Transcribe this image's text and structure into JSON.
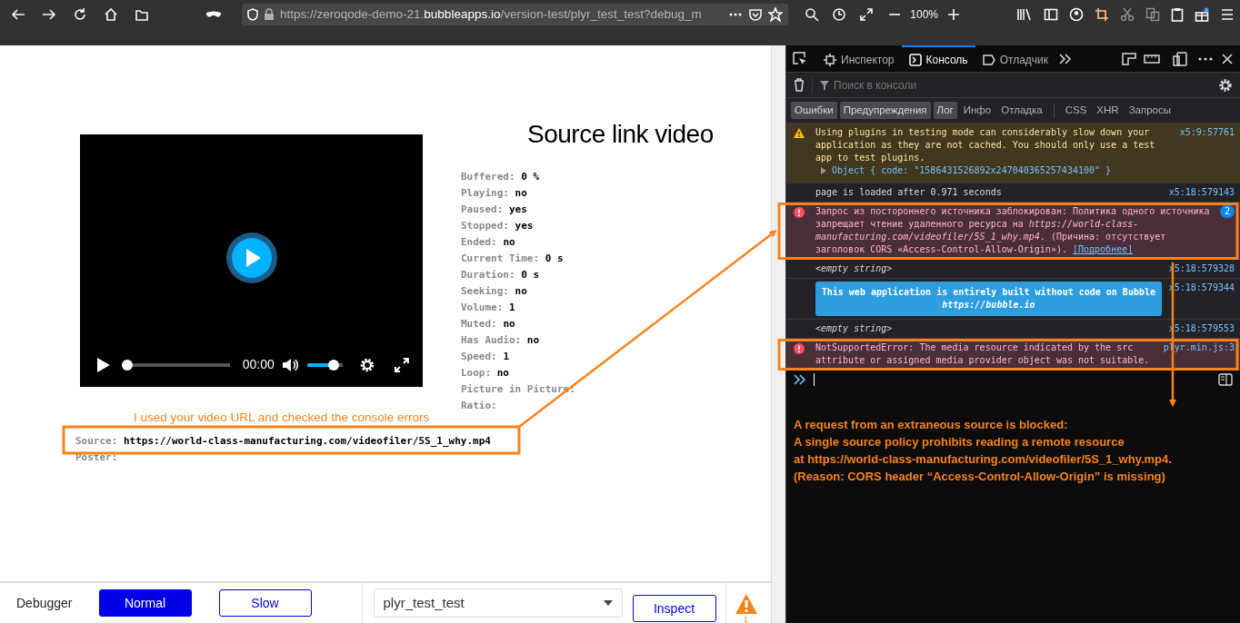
{
  "browser": {
    "url": {
      "prefix": "https://zeroqode-demo-21.",
      "domain": "bubbleapps.io",
      "path": "/version-test/plyr_test_test?debug_m"
    },
    "zoom": "100%"
  },
  "page": {
    "heading": "Source link video",
    "player": {
      "time": "00:00",
      "progress": {
        "level": 0
      },
      "volume": {
        "level": 0.85
      }
    },
    "stats": [
      {
        "label": "Buffered:",
        "value": "0 %"
      },
      {
        "label": "Playing:",
        "value": "no"
      },
      {
        "label": "Paused:",
        "value": "yes"
      },
      {
        "label": "Stopped:",
        "value": "yes"
      },
      {
        "label": "Ended:",
        "value": "no"
      },
      {
        "label": "Current Time:",
        "value": "0 s"
      },
      {
        "label": "Duration:",
        "value": "0 s"
      },
      {
        "label": "Seeking:",
        "value": "no"
      },
      {
        "label": "Volume:",
        "value": "1"
      },
      {
        "label": "Muted:",
        "value": "no"
      },
      {
        "label": "Has Audio:",
        "value": "no"
      },
      {
        "label": "Speed:",
        "value": "1"
      },
      {
        "label": "Loop:",
        "value": "no"
      },
      {
        "label": "Picture in Picture:"
      },
      {
        "label": "Ratio:"
      }
    ],
    "note": "I used your video URL and checked the console errors",
    "source": {
      "label": "Source:",
      "value": "https://world-class-manufacturing.com/videofiler/5S_1_why.mp4"
    },
    "poster": {
      "label": "Poster:"
    }
  },
  "debugger": {
    "label": "Debugger",
    "modes": [
      {
        "label": "Normal",
        "selected": true
      },
      {
        "label": "Slow",
        "selected": false
      }
    ],
    "element": "plyr_test_test",
    "inspect": "Inspect",
    "warnings": "1"
  },
  "devtools": {
    "tabs": [
      {
        "label": "Инспектор",
        "selected": false,
        "kind": "inspector"
      },
      {
        "label": "Консоль",
        "selected": true,
        "kind": "console"
      },
      {
        "label": "Отладчик",
        "selected": false,
        "kind": "debugger"
      }
    ],
    "search_placeholder": "Поиск в консоли",
    "filters": [
      {
        "label": "Ошибки",
        "selected": true
      },
      {
        "label": "Предупреждения",
        "selected": true
      },
      {
        "label": "Лог",
        "selected": true
      },
      {
        "label": "Инфо",
        "selected": false
      },
      {
        "label": "Отладка",
        "selected": false
      },
      {
        "label": "CSS",
        "selected": false
      },
      {
        "label": "XHR",
        "selected": false
      },
      {
        "label": "Запросы",
        "selected": false
      }
    ],
    "messages": [
      {
        "kind": "warning",
        "text": "Using plugins in testing mode can considerably slow down your application as they are not cached. You should only use a test app to test plugins.",
        "object": "Object { code: \"1586431526892x247040365257434100\" }",
        "location": "x5:9:57761"
      },
      {
        "kind": "log",
        "text": "page is loaded after 0.971 seconds",
        "location": "x5:18:579143"
      },
      {
        "kind": "error",
        "text": "Запрос из постороннего источника заблокирован: Политика одного источника запрещает чтение удаленного ресурса на *https://world-class-manufacturing.com/videofiler/5S_1_why.mp4*. (Причина: отсутствует заголовок CORS «Access-Control-Allow-Origin»).",
        "link": "[Подробнее]",
        "count": "2",
        "highlighted": true
      },
      {
        "kind": "empty",
        "text": "<empty string>",
        "location": "x5:18:579328"
      },
      {
        "kind": "styled",
        "text": "This web application is entirely built without code on Bubble",
        "subtext": "https://bubble.io",
        "location": "x5:18:579344"
      },
      {
        "kind": "empty",
        "text": "<empty string>",
        "location": "x5:18:579553"
      },
      {
        "kind": "error",
        "text": "NotSupportedError: The media resource indicated by the src attribute or assigned media provider object was not suitable.",
        "location": "plyr.min.js:3",
        "highlighted": true
      }
    ],
    "explanation": [
      "A request from an extraneous source is blocked:",
      "A single source policy prohibits reading a remote resource",
      "at https://world-class-manufacturing.com/videofiler/5S_1_why.mp4.",
      "(Reason: CORS header “Access-Control-Allow-Origin” is missing)"
    ]
  }
}
